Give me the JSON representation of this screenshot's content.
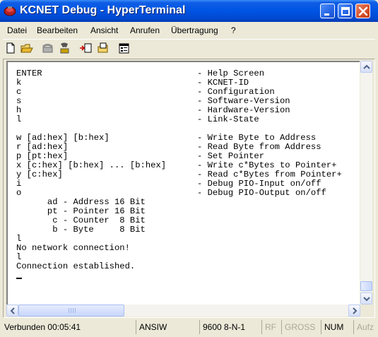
{
  "window": {
    "title": "KCNET Debug - HyperTerminal"
  },
  "menu": [
    {
      "label": "Datei"
    },
    {
      "label": "Bearbeiten"
    },
    {
      "label": "Ansicht"
    },
    {
      "label": "Anrufen"
    },
    {
      "label": "Übertragung"
    },
    {
      "label": "?"
    }
  ],
  "toolbar": [
    {
      "icon": "new-file-icon"
    },
    {
      "icon": "open-folder-icon"
    },
    {
      "icon": "phone-call-icon"
    },
    {
      "icon": "disconnect-icon"
    },
    {
      "icon": "send-file-icon"
    },
    {
      "icon": "receive-file-icon"
    },
    {
      "icon": "properties-icon"
    }
  ],
  "terminal": {
    "lines": [
      "ENTER                              - Help Screen",
      "k                                  - KCNET-ID",
      "c                                  - Configuration",
      "s                                  - Software-Version",
      "h                                  - Hardware-Version",
      "l                                  - Link-State",
      "",
      "w [ad:hex] [b:hex]                 - Write Byte to Address",
      "r [ad:hex]                         - Read Byte from Address",
      "p [pt:hex]                         - Set Pointer",
      "x [c:hex] [b:hex] ... [b:hex]      - Write c*Bytes to Pointer+",
      "y [c:hex]                          - Read c*Bytes from Pointer+",
      "i                                  - Debug PIO-Input on/off",
      "o                                  - Debug PIO-Output on/off",
      "      ad - Address 16 Bit",
      "      pt - Pointer 16 Bit",
      "       c - Counter  8 Bit",
      "       b - Byte     8 Bit",
      "l",
      "No network connection!",
      "l",
      "Connection established."
    ]
  },
  "status": {
    "connection": "Verbunden 00:05:41",
    "emulation": "ANSIW",
    "port_settings": "9600 8-N-1",
    "scroll": "RF",
    "caps": "GROSS",
    "num": "NUM",
    "capture": "Aufz"
  },
  "colors": {
    "titlebar": "#0054e3",
    "close_button": "#d9522b",
    "chrome": "#ece9d8",
    "terminal_bg": "#ffffff"
  }
}
